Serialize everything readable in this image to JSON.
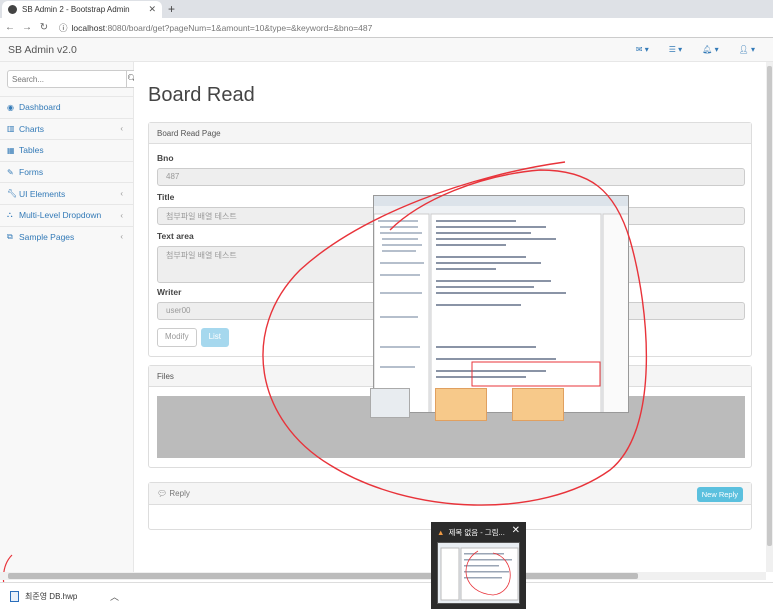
{
  "browser": {
    "tab_title": "SB Admin 2 - Bootstrap Admin",
    "url_host": "localhost",
    "url_path": ":8080/board/get?pageNum=1&amount=10&type=&keyword=&bno=487"
  },
  "navbar": {
    "brand": "SB Admin v2.0"
  },
  "sidebar": {
    "search_placeholder": "Search...",
    "items": [
      {
        "label": "Dashboard",
        "icon": "dashboard-icon",
        "arrow": ""
      },
      {
        "label": "Charts",
        "icon": "chart-icon",
        "arrow": "‹"
      },
      {
        "label": "Tables",
        "icon": "table-icon",
        "arrow": ""
      },
      {
        "label": "Forms",
        "icon": "edit-icon",
        "arrow": ""
      },
      {
        "label": "UI Elements",
        "icon": "wrench-icon",
        "arrow": "‹"
      },
      {
        "label": "Multi-Level Dropdown",
        "icon": "sitemap-icon",
        "arrow": "‹"
      },
      {
        "label": "Sample Pages",
        "icon": "files-icon",
        "arrow": "‹"
      }
    ]
  },
  "main": {
    "page_title": "Board Read",
    "panel_heading": "Board Read Page",
    "bno_label": "Bno",
    "bno_value": "487",
    "title_label": "Title",
    "title_value": "첨부파일 배열 테스트",
    "text_label": "Text area",
    "text_value": "첨부파일 배열 테스트",
    "writer_label": "Writer",
    "writer_value": "user00",
    "modify_label": "Modify",
    "list_label": "List",
    "files_heading": "Files",
    "reply_heading": "Reply",
    "new_reply_label": "New Reply"
  },
  "downloads": {
    "file": "최준영 DB.hwp"
  },
  "taskbar_popup": {
    "title": "제목 없음 - 그림..."
  },
  "colors": {
    "link": "#337ab7",
    "info": "#5bc0de",
    "annotation": "#e8333a"
  }
}
